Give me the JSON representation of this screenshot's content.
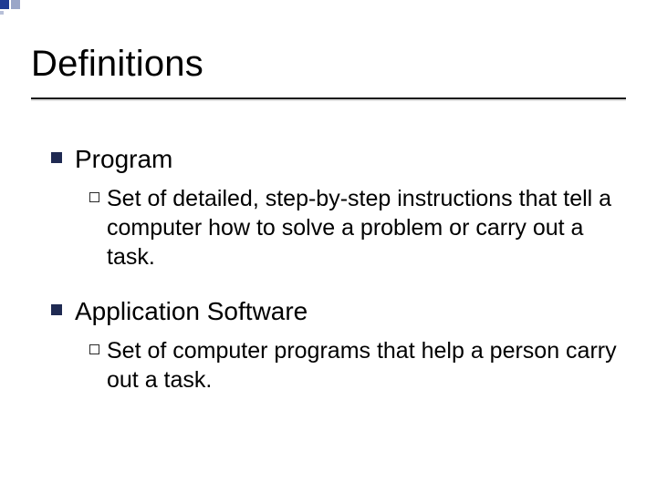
{
  "slide": {
    "title": "Definitions",
    "items": [
      {
        "heading": "Program",
        "sub": "Set of detailed, step-by-step instructions that tell a computer how to solve a problem or carry out a task."
      },
      {
        "heading": "Application Software",
        "sub": "Set of computer programs that help a person carry out a task."
      }
    ]
  }
}
